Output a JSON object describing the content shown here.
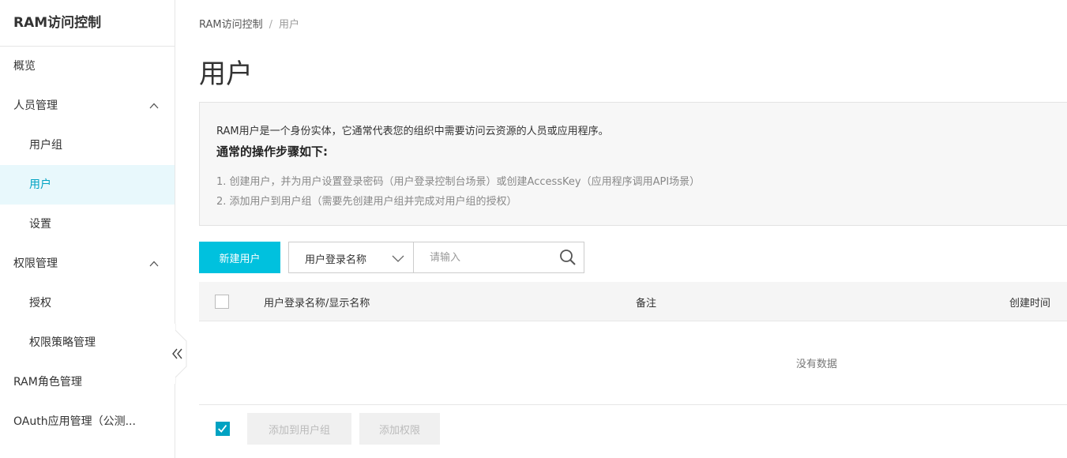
{
  "sidebar": {
    "title": "RAM访问控制",
    "items": [
      {
        "label": "概览"
      },
      {
        "label": "人员管理"
      },
      {
        "label": "用户组"
      },
      {
        "label": "用户"
      },
      {
        "label": "设置"
      },
      {
        "label": "权限管理"
      },
      {
        "label": "授权"
      },
      {
        "label": "权限策略管理"
      },
      {
        "label": "RAM角色管理"
      },
      {
        "label": "OAuth应用管理（公测..."
      }
    ]
  },
  "breadcrumb": {
    "root": "RAM访问控制",
    "separator": "/",
    "current": "用户"
  },
  "page_title": "用户",
  "info": {
    "description": "RAM用户是一个身份实体，它通常代表您的组织中需要访问云资源的人员或应用程序。",
    "subtitle": "通常的操作步骤如下:",
    "steps": [
      "1. 创建用户，并为用户设置登录密码（用户登录控制台场景）或创建AccessKey（应用程序调用API场景）",
      "2. 添加用户到用户组（需要先创建用户组并完成对用户组的授权）"
    ]
  },
  "toolbar": {
    "new_user_label": "新建用户",
    "filter_select": "用户登录名称",
    "search_placeholder": "请输入"
  },
  "table": {
    "columns": [
      "用户登录名称/显示名称",
      "备注",
      "创建时间"
    ],
    "empty_text": "没有数据"
  },
  "footer": {
    "add_to_group_label": "添加到用户组",
    "add_permission_label": "添加权限"
  },
  "colors": {
    "accent": "#00c1de",
    "active_bg": "#e8f8fc",
    "active_text": "#00a2c2"
  }
}
